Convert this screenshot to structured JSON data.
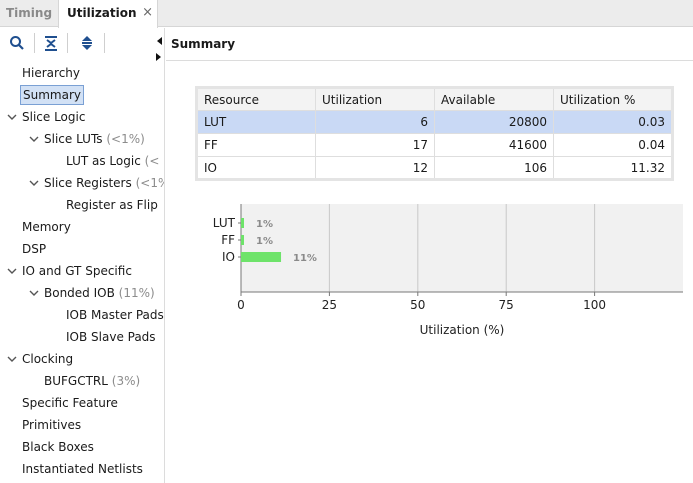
{
  "tabs": [
    {
      "label": "Timing"
    },
    {
      "label": "Utilization"
    }
  ],
  "close_glyph": "×",
  "toolbar": {
    "icons": [
      "search-icon",
      "collapse-all-icon",
      "expand-all-icon"
    ]
  },
  "tree": {
    "items": [
      {
        "label": "Hierarchy",
        "extra": ""
      },
      {
        "label": "Summary",
        "extra": ""
      },
      {
        "label": "Slice Logic",
        "extra": ""
      },
      {
        "label": "Slice LUTs",
        "extra": "(<1%)"
      },
      {
        "label": "LUT as Logic",
        "extra": "(<"
      },
      {
        "label": "Slice Registers",
        "extra": "(<1%"
      },
      {
        "label": "Register as Flip",
        "extra": ""
      },
      {
        "label": "Memory",
        "extra": ""
      },
      {
        "label": "DSP",
        "extra": ""
      },
      {
        "label": "IO and GT Specific",
        "extra": ""
      },
      {
        "label": "Bonded IOB",
        "extra": "(11%)"
      },
      {
        "label": "IOB Master Pads",
        "extra": ""
      },
      {
        "label": "IOB Slave Pads",
        "extra": ""
      },
      {
        "label": "Clocking",
        "extra": ""
      },
      {
        "label": "BUFGCTRL",
        "extra": "(3%)"
      },
      {
        "label": "Specific Feature",
        "extra": ""
      },
      {
        "label": "Primitives",
        "extra": ""
      },
      {
        "label": "Black Boxes",
        "extra": ""
      },
      {
        "label": "Instantiated Netlists",
        "extra": ""
      }
    ]
  },
  "summary": {
    "title": "Summary",
    "table": {
      "headers": [
        "Resource",
        "Utilization",
        "Available",
        "Utilization %"
      ],
      "rows": [
        [
          "LUT",
          "6",
          "20800",
          "0.03"
        ],
        [
          "FF",
          "17",
          "41600",
          "0.04"
        ],
        [
          "IO",
          "12",
          "106",
          "11.32"
        ]
      ]
    }
  },
  "chart_data": {
    "type": "bar",
    "orientation": "horizontal",
    "categories": [
      "LUT",
      "FF",
      "IO"
    ],
    "values": [
      0.03,
      0.04,
      11.32
    ],
    "data_labels": [
      "1%",
      "1%",
      "11%"
    ],
    "xlabel": "Utilization (%)",
    "ylabel": "",
    "xticks": [
      "0",
      "25",
      "50",
      "75",
      "100"
    ],
    "xlim": [
      0,
      125
    ],
    "grid": true,
    "bar_color": "#6ee36a"
  }
}
